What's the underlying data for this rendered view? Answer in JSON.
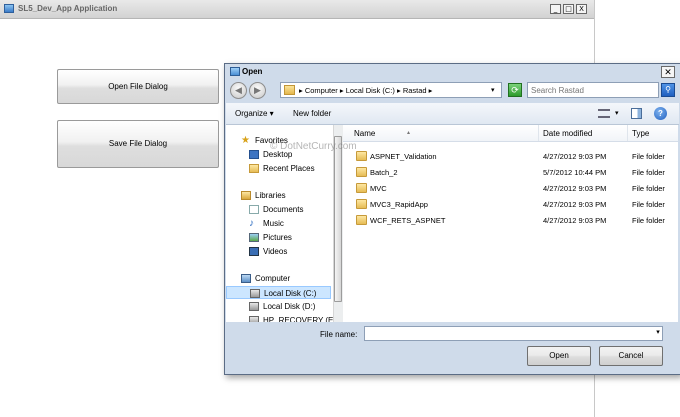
{
  "app": {
    "title": "SL5_Dev_App Application",
    "open_file_button": "Open File Dialog",
    "save_file_button": "Save File Dialog",
    "min_glyph": "_",
    "max_glyph": "□",
    "close_glyph": "X"
  },
  "dialog": {
    "title": "Open",
    "close_glyph": "✕",
    "back_glyph": "◀",
    "forward_glyph": "▶",
    "address_path": "▸ Computer ▸ Local Disk (C:) ▸ Rastad ▸",
    "dropdown_glyph": "▾",
    "refresh_glyph": "⟳",
    "search_placeholder": "Search Rastad",
    "search_glyph": "⚲",
    "organize_label": "Organize ▾",
    "new_folder_label": "New folder",
    "help_glyph": "?",
    "nav_pane": {
      "items": [
        {
          "label": "Favorites",
          "icon": "star-icon"
        },
        {
          "label": "Desktop",
          "icon": "desktop-icon"
        },
        {
          "label": "Recent Places",
          "icon": "recent-places-icon"
        },
        {
          "label": "Libraries",
          "icon": "libraries-icon"
        },
        {
          "label": "Documents",
          "icon": "documents-icon"
        },
        {
          "label": "Music",
          "icon": "music-icon"
        },
        {
          "label": "Pictures",
          "icon": "pictures-icon"
        },
        {
          "label": "Videos",
          "icon": "videos-icon"
        },
        {
          "label": "Computer",
          "icon": "computer-icon"
        },
        {
          "label": "Local Disk (C:)",
          "icon": "drive-icon"
        },
        {
          "label": "Local Disk (D:)",
          "icon": "drive-icon"
        },
        {
          "label": "HP_RECOVERY (E",
          "icon": "drive-icon"
        }
      ]
    },
    "columns": {
      "name": "Name",
      "sort_glyph": "▴",
      "date_modified": "Date modified",
      "type": "Type"
    },
    "files": [
      {
        "name": "ASPNET_Validation",
        "date": "4/27/2012 9:03 PM",
        "type": "File folder"
      },
      {
        "name": "Batch_2",
        "date": "5/7/2012 10:44 PM",
        "type": "File folder"
      },
      {
        "name": "MVC",
        "date": "4/27/2012 9:03 PM",
        "type": "File folder"
      },
      {
        "name": "MVC3_RapidApp",
        "date": "4/27/2012 9:03 PM",
        "type": "File folder"
      },
      {
        "name": "WCF_RETS_ASPNET",
        "date": "4/27/2012 9:03 PM",
        "type": "File folder"
      }
    ],
    "file_name_label": "File name:",
    "file_name_value": "",
    "open_button": "Open",
    "cancel_button": "Cancel"
  },
  "watermark": "© DotNetCurry.com"
}
